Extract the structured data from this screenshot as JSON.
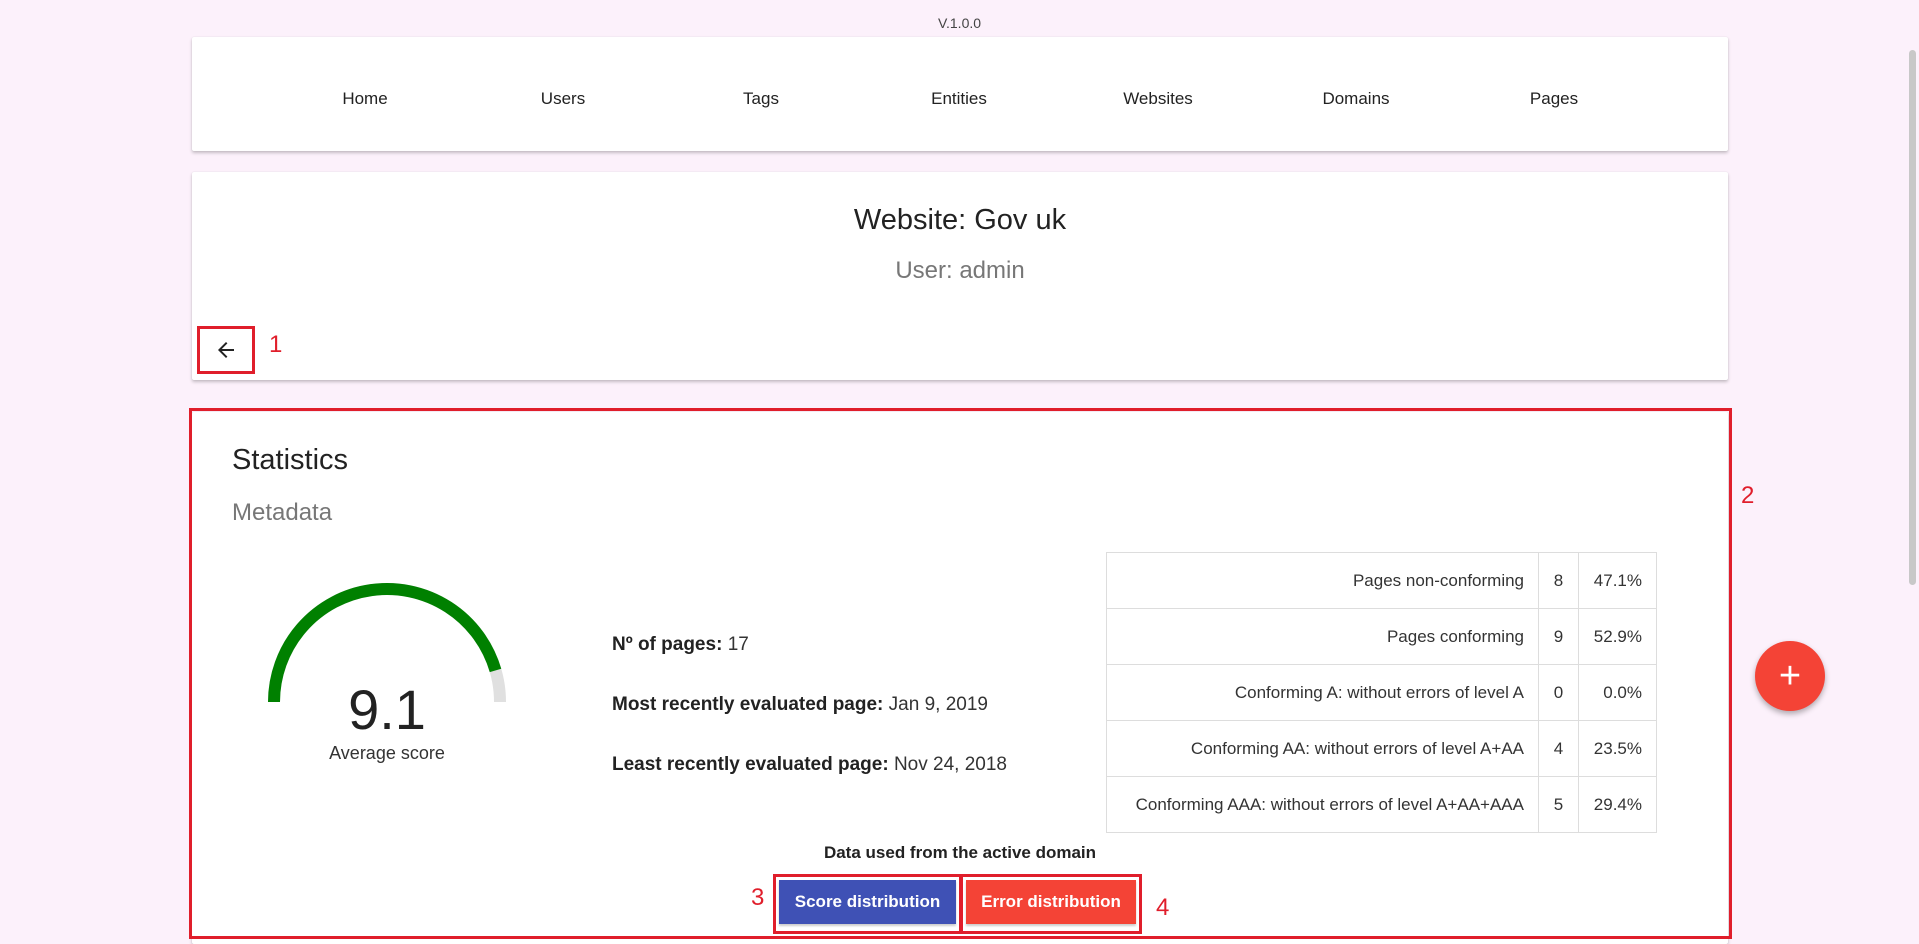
{
  "version": "V.1.0.0",
  "nav": {
    "items": [
      "Home",
      "Users",
      "Tags",
      "Entities",
      "Websites",
      "Domains",
      "Pages"
    ]
  },
  "header": {
    "title": "Website: Gov uk",
    "subtitle": "User: admin",
    "back_icon": "arrow-left-icon"
  },
  "annotations": [
    "1",
    "2",
    "3",
    "4"
  ],
  "stats": {
    "title": "Statistics",
    "subtitle": "Metadata",
    "gauge": {
      "value": "9.1",
      "label": "Average score",
      "fraction": 0.91,
      "color": "#008000",
      "track_color": "#e0e0e0"
    },
    "meta": {
      "pages_label": "Nº of pages:",
      "pages_value": "17",
      "recent_label": "Most recently evaluated page:",
      "recent_value": "Jan 9, 2019",
      "least_label": "Least recently evaluated page:",
      "least_value": "Nov 24, 2018"
    },
    "table": [
      {
        "label": "Pages non-conforming",
        "count": "8",
        "pct": "47.1%"
      },
      {
        "label": "Pages conforming",
        "count": "9",
        "pct": "52.9%"
      },
      {
        "label": "Conforming A: without errors of level A",
        "count": "0",
        "pct": "0.0%"
      },
      {
        "label": "Conforming AA: without errors of level A+AA",
        "count": "4",
        "pct": "23.5%"
      },
      {
        "label": "Conforming AAA: without errors of level A+AA+AAA",
        "count": "5",
        "pct": "29.4%"
      }
    ],
    "data_used": "Data used from the active domain",
    "score_button": "Score distribution",
    "error_button": "Error distribution"
  },
  "colors": {
    "score_button": "#3f51b5",
    "error_button": "#f44336",
    "annotation": "#e01e2b"
  },
  "fab": {
    "label": "+",
    "icon": "plus-icon"
  }
}
